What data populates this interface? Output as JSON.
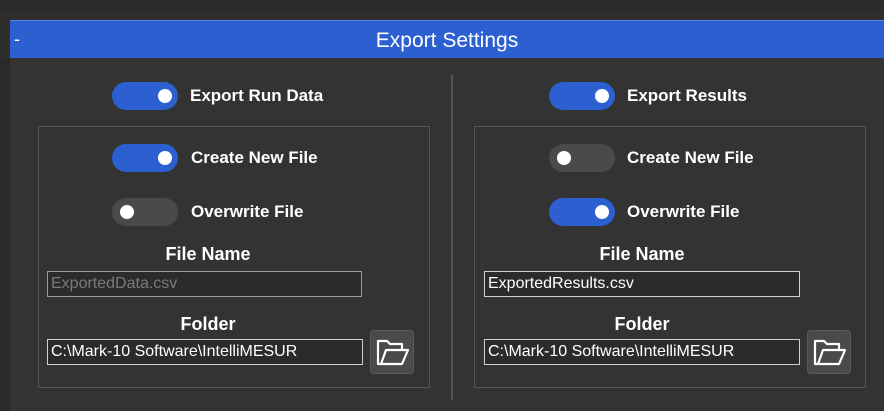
{
  "header": {
    "collapse_symbol": "-",
    "title": "Export Settings"
  },
  "run_data": {
    "export_label": "Export Run Data",
    "export_on": true,
    "create_new_file_label": "Create New File",
    "create_new_file_on": true,
    "overwrite_file_label": "Overwrite File",
    "overwrite_file_on": false,
    "file_name_label": "File Name",
    "file_name_value": "ExportedData.csv",
    "file_name_disabled": true,
    "folder_label": "Folder",
    "folder_value": "C:\\Mark-10 Software\\IntelliMESUR"
  },
  "results": {
    "export_label": "Export Results",
    "export_on": true,
    "create_new_file_label": "Create New File",
    "create_new_file_on": false,
    "overwrite_file_label": "Overwrite File",
    "overwrite_file_on": true,
    "file_name_label": "File Name",
    "file_name_value": "ExportedResults.csv",
    "file_name_disabled": false,
    "folder_label": "Folder",
    "folder_value": "C:\\Mark-10 Software\\IntelliMESUR"
  },
  "icons": {
    "folder": "folder-open-icon"
  },
  "colors": {
    "accent": "#2c5fd0",
    "toggle_off": "#4a4a4a",
    "background": "#333333"
  }
}
